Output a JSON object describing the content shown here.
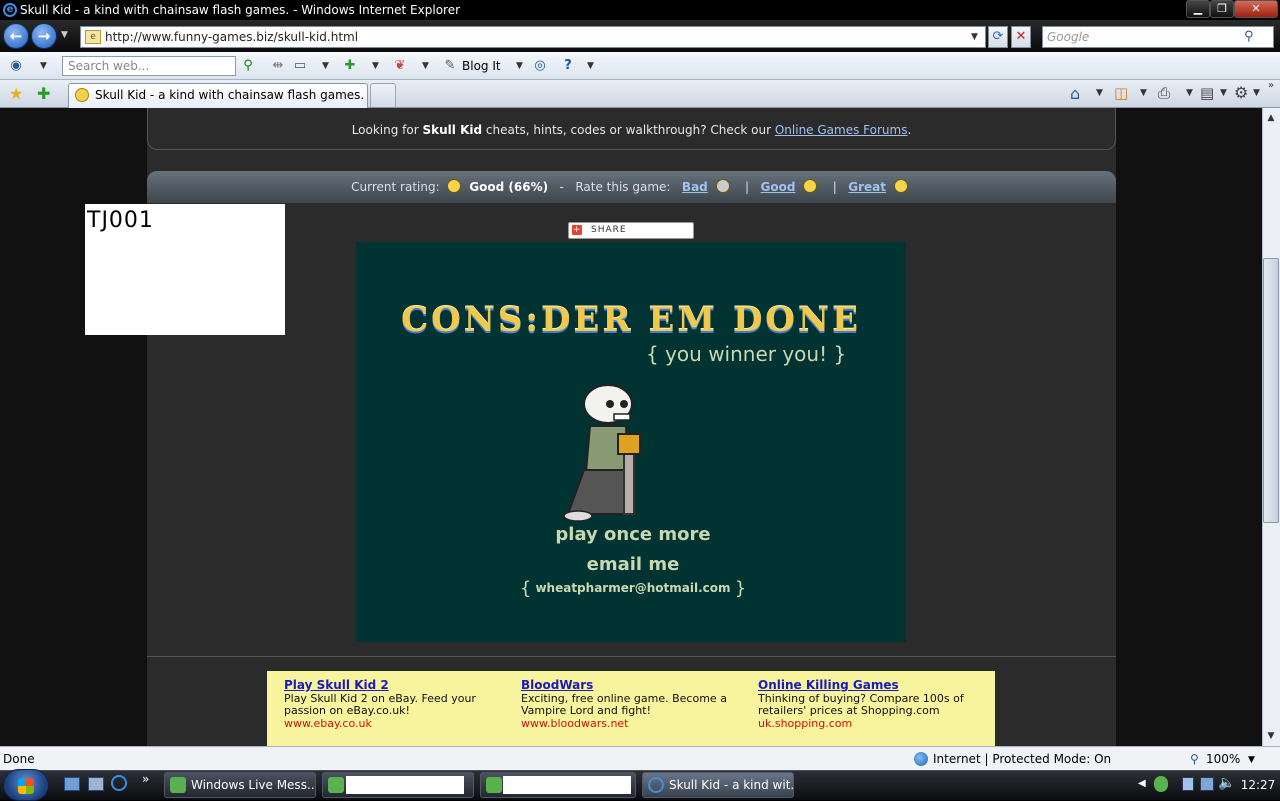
{
  "window": {
    "title": "Skull Kid - a kind with chainsaw flash games. - Windows Internet Explorer",
    "min": "▁",
    "max": "❐",
    "close": "✕"
  },
  "nav": {
    "url": "http://www.funny-games.biz/skull-kid.html",
    "search_placeholder": "Google"
  },
  "toolbar": {
    "search_placeholder": "Search web...",
    "blog_it": "Blog It"
  },
  "tab": {
    "title": "Skull Kid - a kind with chainsaw flash games."
  },
  "page": {
    "forum_pre": "Looking for ",
    "forum_game": "Skull Kid",
    "forum_mid": " cheats, hints, codes or walkthrough? Check our ",
    "forum_link": "Online Games Forums",
    "forum_post": ".",
    "rating_label": "Current rating:",
    "rating_value": "Good (66%)",
    "rate_this": "Rate this game:",
    "bad": "Bad",
    "good": "Good",
    "great": "Great",
    "sep": "|",
    "dash": "-",
    "share": "SHARE",
    "white_box_text": "TJ001"
  },
  "game": {
    "title": "CONS:DER EM DONE",
    "subtitle": "{ you winner you! }",
    "play_again": "play once more",
    "email_me": "email me",
    "email": "wheatpharmer@hotmail.com",
    "brace_open": "{",
    "brace_close": "}"
  },
  "ads": [
    {
      "headline": "Play Skull Kid 2",
      "body": "Play Skull Kid 2 on eBay. Feed your passion on eBay.co.uk!",
      "url": "www.ebay.co.uk"
    },
    {
      "headline": "BloodWars",
      "body": "Exciting, free online game. Become a Vampire Lord and fight!",
      "url": "www.bloodwars.net"
    },
    {
      "headline": "Online Killing Games",
      "body": "Thinking of buying? Compare 100s of retailers' prices at Shopping.com",
      "url": "uk.shopping.com"
    }
  ],
  "status": {
    "left": "Done",
    "zone": "Internet | Protected Mode: On",
    "zoom": "100%"
  },
  "taskbar": {
    "items": [
      {
        "label": "Windows Live Mess..."
      },
      {
        "label": ""
      },
      {
        "label": ""
      },
      {
        "label": "Skull Kid - a kind wit..."
      }
    ],
    "clock": "12:27"
  },
  "colors": {
    "game_bg": "#003332",
    "ad_bg": "#f8f49e",
    "page_col": "#2b2b2b"
  }
}
